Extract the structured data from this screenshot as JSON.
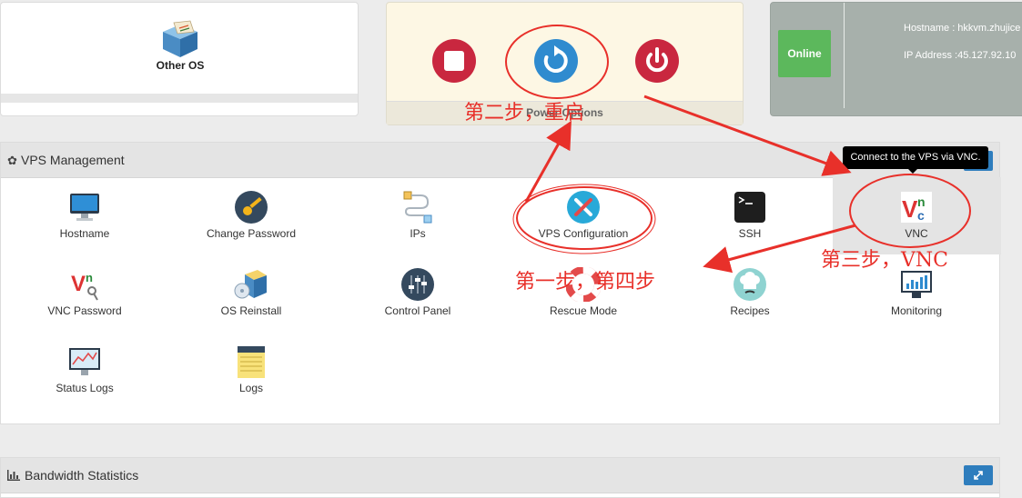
{
  "os_card": {
    "label": "Other OS",
    "icon": "os-box-icon"
  },
  "power": {
    "label": "Power Options",
    "buttons": [
      "stop-icon",
      "restart-icon",
      "power-off-icon"
    ],
    "colors": {
      "stop": "#c9273f",
      "restart": "#2f8bcf",
      "poweroff": "#c9273f"
    }
  },
  "status": {
    "state": "Online",
    "hostname": "Hostname : hkkvm.zhujice",
    "ip": "IP Address :45.127.92.10"
  },
  "vps": {
    "title": "VPS Management",
    "tooltip": "Connect to the VPS via VNC.",
    "tiles": [
      {
        "label": "Hostname",
        "icon": "monitor-icon"
      },
      {
        "label": "Change Password",
        "icon": "key-icon"
      },
      {
        "label": "IPs",
        "icon": "network-icon"
      },
      {
        "label": "VPS Configuration",
        "icon": "tools-icon"
      },
      {
        "label": "SSH",
        "icon": "terminal-icon"
      },
      {
        "label": "VNC",
        "icon": "vnc-icon"
      },
      {
        "label": "VNC Password",
        "icon": "vnc-key-icon"
      },
      {
        "label": "OS Reinstall",
        "icon": "reinstall-icon"
      },
      {
        "label": "Control Panel",
        "icon": "sliders-icon"
      },
      {
        "label": "Rescue Mode",
        "icon": "lifebuoy-icon"
      },
      {
        "label": "Recipes",
        "icon": "chef-icon"
      },
      {
        "label": "Monitoring",
        "icon": "monitoring-icon"
      },
      {
        "label": "Status Logs",
        "icon": "status-chart-icon"
      },
      {
        "label": "Logs",
        "icon": "notepad-icon"
      }
    ]
  },
  "bandwidth": {
    "title": "Bandwidth Statistics"
  },
  "annotations": {
    "step2": "第二步，重启",
    "step3": "第三步，VNC",
    "step14": "第一步，第四步",
    "color": "#e8302a"
  }
}
